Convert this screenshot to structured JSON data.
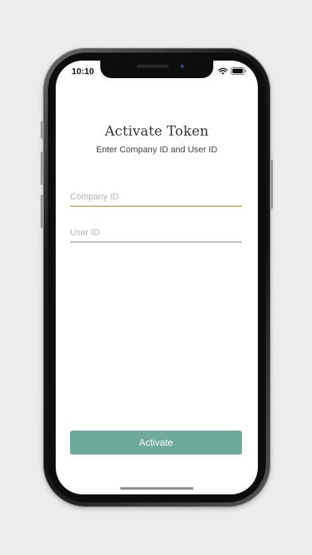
{
  "status_bar": {
    "time": "10:10",
    "icons": [
      "wifi-icon",
      "battery-icon"
    ]
  },
  "header": {
    "title": "Activate Token",
    "subtitle": "Enter Company ID and User ID"
  },
  "form": {
    "company_id": {
      "value": "",
      "placeholder": "Company ID"
    },
    "user_id": {
      "value": "",
      "placeholder": "User ID"
    }
  },
  "actions": {
    "activate_label": "Activate"
  },
  "colors": {
    "accent_button": "#6fa99b",
    "field_underline": "#a8874a",
    "background": "#ececec"
  }
}
